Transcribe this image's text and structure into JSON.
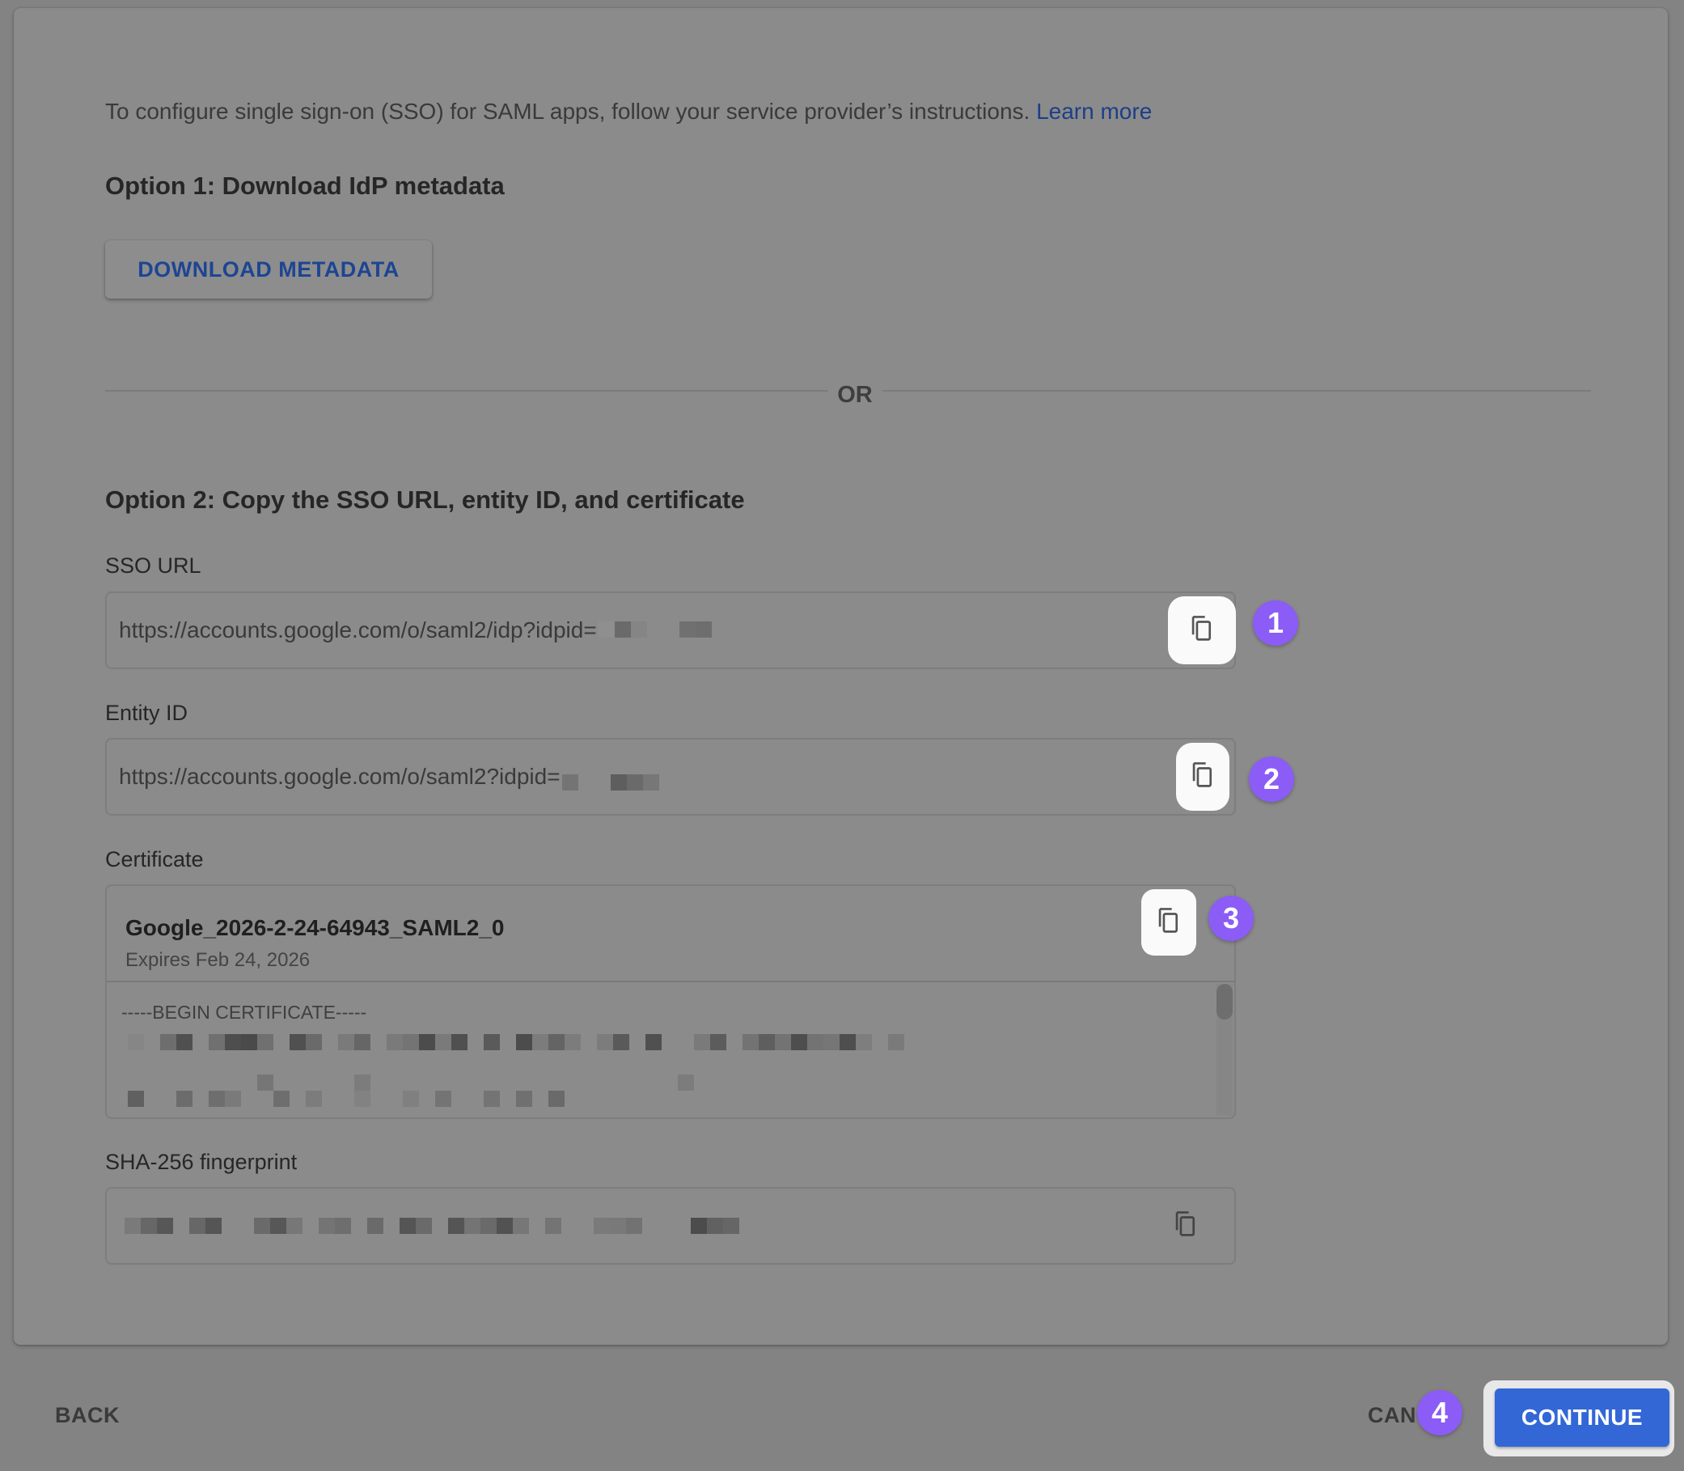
{
  "intro": {
    "text": "To configure single sign-on (SSO) for SAML apps, follow your service provider’s instructions.",
    "learn_more": "Learn more"
  },
  "option1": {
    "heading": "Option 1: Download IdP metadata",
    "download_button": "DOWNLOAD METADATA"
  },
  "divider": {
    "label": "OR"
  },
  "option2": {
    "heading": "Option 2: Copy the SSO URL, entity ID, and certificate",
    "sso_url": {
      "label": "SSO URL",
      "value": "https://accounts.google.com/o/saml2/idp?idpid=",
      "redacted": true,
      "copy_icon": "copy-icon"
    },
    "entity_id": {
      "label": "Entity ID",
      "value": "https://accounts.google.com/o/saml2?idpid=",
      "redacted": true,
      "copy_icon": "copy-icon"
    },
    "certificate": {
      "label": "Certificate",
      "name": "Google_2026-2-24-64943_SAML2_0",
      "expires": "Expires Feb 24, 2026",
      "begin_marker": "-----BEGIN CERTIFICATE-----",
      "redacted": true,
      "copy_icon": "copy-icon"
    },
    "fingerprint": {
      "label": "SHA-256 fingerprint",
      "redacted": true,
      "copy_icon": "copy-icon"
    }
  },
  "annotations": [
    "1",
    "2",
    "3",
    "4"
  ],
  "footer": {
    "back": "BACK",
    "cancel": "CANCEL",
    "continue": "CONTINUE"
  },
  "colors": {
    "accent_button": "#3367d6",
    "link": "#1c3f87",
    "badge": "#8b5cf6"
  }
}
